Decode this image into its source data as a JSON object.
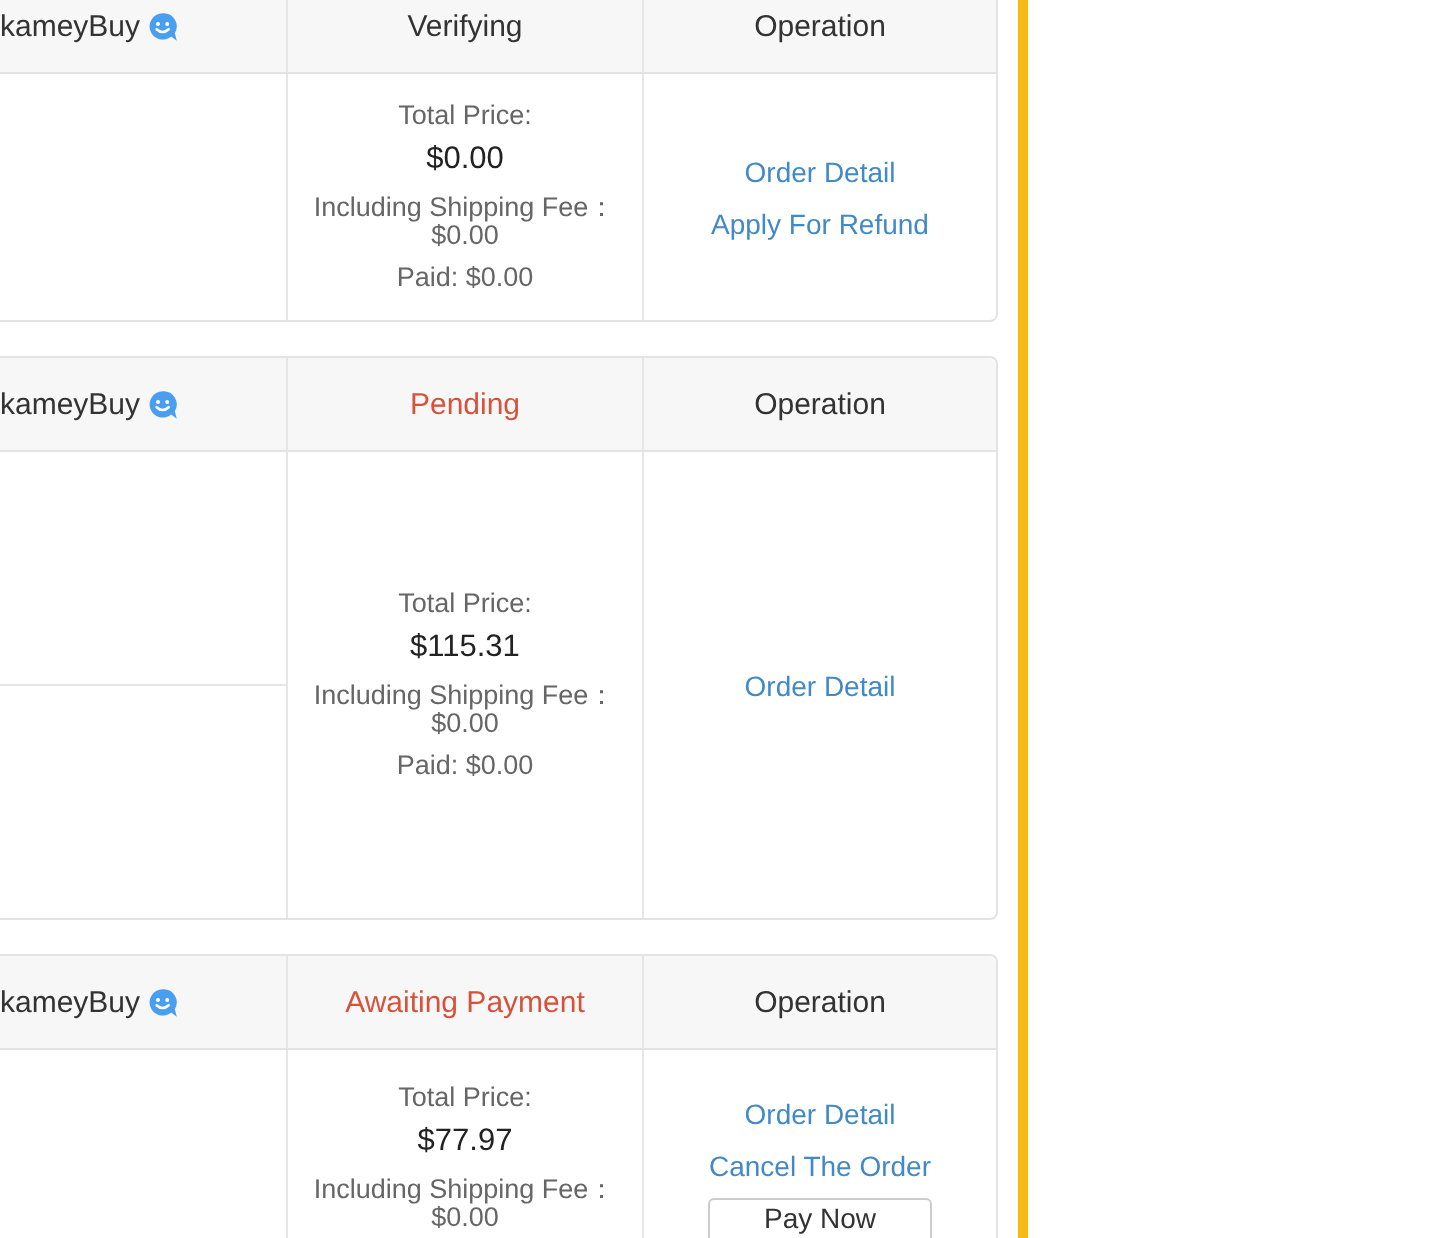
{
  "orders": [
    {
      "shop": "kameyBuy",
      "status": {
        "text": "Verifying",
        "color": "#333333"
      },
      "operation_header": "Operation",
      "products": [
        {
          "kind": "blank"
        }
      ],
      "price": {
        "label": "Total Price:",
        "amount": "$0.00",
        "shipping_label": "Including Shipping Fee：",
        "shipping": "$0.00",
        "paid": "Paid: $0.00"
      },
      "actions": [
        {
          "kind": "link",
          "label": "Order Detail"
        },
        {
          "kind": "link",
          "label": "Apply For Refund"
        }
      ]
    },
    {
      "shop": "kameyBuy",
      "status": {
        "text": "Pending",
        "color": "#d6533b"
      },
      "operation_header": "Operation",
      "products": [
        {
          "kind": "blank"
        },
        {
          "kind": "blank"
        }
      ],
      "price": {
        "label": "Total Price:",
        "amount": "$115.31",
        "shipping_label": "Including Shipping Fee：",
        "shipping": "$0.00",
        "paid": "Paid: $0.00"
      },
      "actions": [
        {
          "kind": "link",
          "label": "Order Detail"
        }
      ]
    },
    {
      "shop": "kameyBuy",
      "status": {
        "text": "Awaiting Payment",
        "color": "#d6533b"
      },
      "operation_header": "Operation",
      "products": [
        {
          "kind": "blank"
        }
      ],
      "price": {
        "label": "Total Price:",
        "amount": "$77.97",
        "shipping_label": "Including Shipping Fee：",
        "shipping": "$0.00"
      },
      "actions": [
        {
          "kind": "link",
          "label": "Order Detail"
        },
        {
          "kind": "link",
          "label": "Cancel The Order"
        },
        {
          "kind": "button",
          "label": "Pay Now"
        }
      ]
    }
  ]
}
